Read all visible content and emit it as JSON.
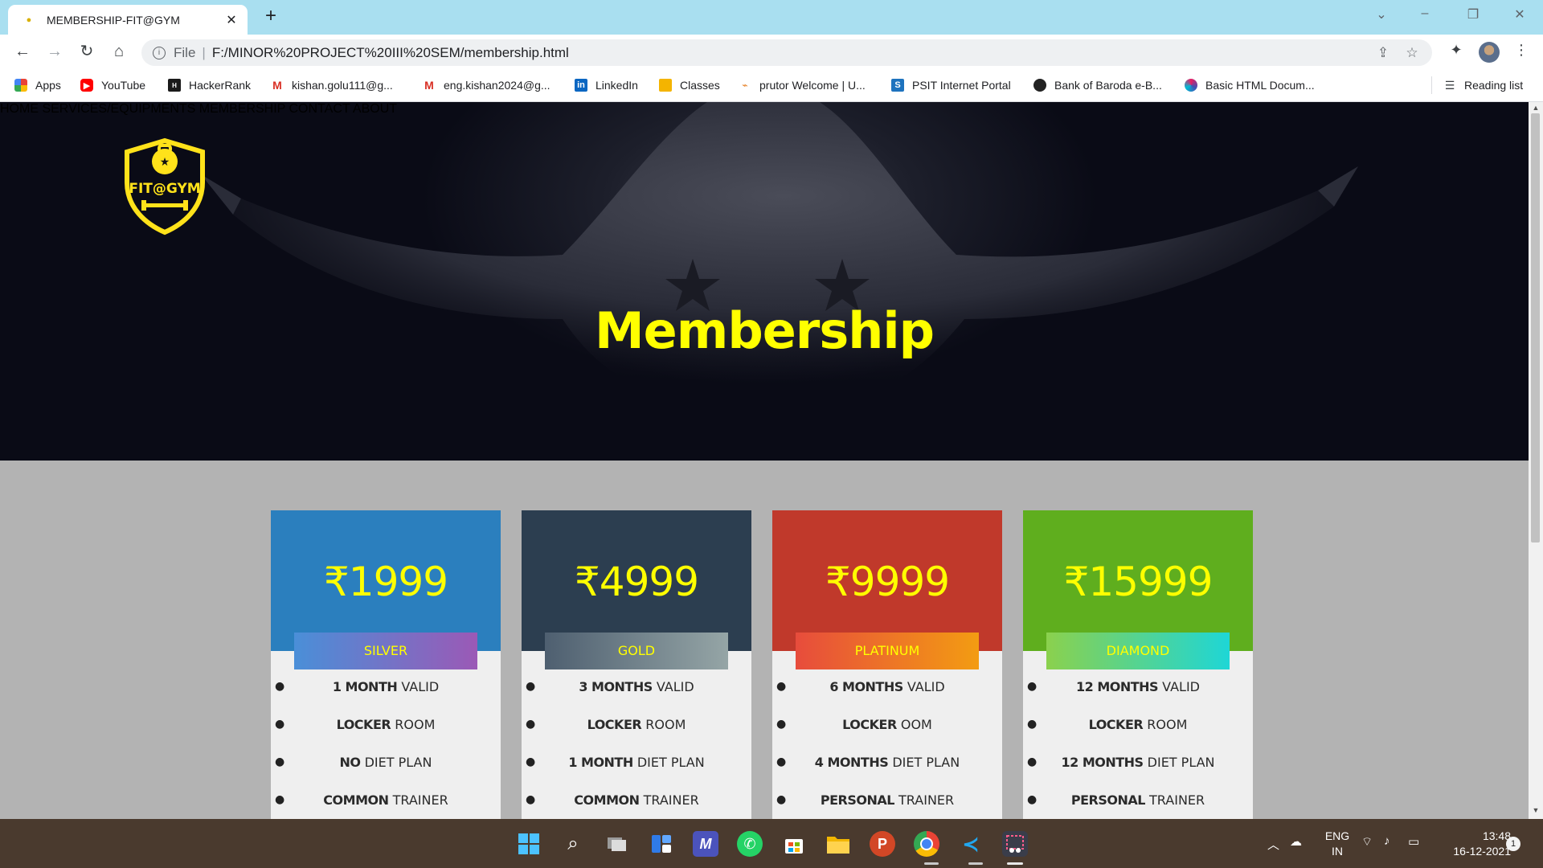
{
  "browser": {
    "tab_title": "MEMBERSHIP-FIT@GYM",
    "url_scheme": "File",
    "url": "F:/MINOR%20PROJECT%20III%20SEM/membership.html",
    "reading_list": "Reading list",
    "bookmarks": [
      {
        "label": "Apps",
        "icon": "apps-grid-icon"
      },
      {
        "label": "YouTube",
        "icon": "youtube-icon"
      },
      {
        "label": "HackerRank",
        "icon": "hackerrank-icon"
      },
      {
        "label": "kishan.golu111@g...",
        "icon": "gmail-icon"
      },
      {
        "label": "eng.kishan2024@g...",
        "icon": "gmail-icon"
      },
      {
        "label": "LinkedIn",
        "icon": "linkedin-icon"
      },
      {
        "label": "Classes",
        "icon": "classroom-icon"
      },
      {
        "label": "prutor Welcome | U...",
        "icon": "prutor-icon"
      },
      {
        "label": "PSIT Internet Portal",
        "icon": "psit-icon"
      },
      {
        "label": "Bank of Baroda e-B...",
        "icon": "globe-icon"
      },
      {
        "label": "Basic HTML Docum...",
        "icon": "swirl-icon"
      }
    ]
  },
  "site": {
    "logo_text": "FIT@GYM",
    "nav": [
      "HOME",
      "SERVICES/EQUIPMENTS",
      "MEMBERSHIP",
      "CONTACT",
      "ABOUT"
    ],
    "page_title": "Membership"
  },
  "plans": [
    {
      "price": "₹1999",
      "tier": "SILVER",
      "color": "#2b7fbe",
      "tier_gradient": [
        "#4a8fd8",
        "#9b59b6"
      ],
      "features": [
        [
          "1 MONTH",
          "VALID"
        ],
        [
          "LOCKER",
          "ROOM"
        ],
        [
          "NO",
          "DIET PLAN"
        ],
        [
          "COMMON",
          "TRAINER"
        ]
      ]
    },
    {
      "price": "₹4999",
      "tier": "GOLD",
      "color": "#2c3e50",
      "tier_gradient": [
        "#4e5f70",
        "#95a5a6"
      ],
      "features": [
        [
          "3 MONTHS",
          "VALID"
        ],
        [
          "LOCKER",
          "ROOM"
        ],
        [
          "1 MONTH",
          "DIET PLAN"
        ],
        [
          "COMMON",
          "TRAINER"
        ]
      ]
    },
    {
      "price": "₹9999",
      "tier": "PLATINUM",
      "color": "#c0392b",
      "tier_gradient": [
        "#e74c3c",
        "#f39c12"
      ],
      "features": [
        [
          "6 MONTHS",
          "VALID"
        ],
        [
          "LOCKER",
          "OOM"
        ],
        [
          "4 MONTHS",
          "DIET PLAN"
        ],
        [
          "PERSONAL",
          "TRAINER"
        ]
      ]
    },
    {
      "price": "₹15999",
      "tier": "DIAMOND",
      "color": "#5fae1e",
      "tier_gradient": [
        "#8bd14d",
        "#1ed6d6"
      ],
      "features": [
        [
          "12 MONTHS",
          "VALID"
        ],
        [
          "LOCKER",
          "ROOM"
        ],
        [
          "12 MONTHS",
          "DIET PLAN"
        ],
        [
          "PERSONAL",
          "TRAINER"
        ]
      ]
    }
  ],
  "taskbar": {
    "apps": [
      "windows-start-icon",
      "search-icon",
      "task-view-icon",
      "widgets-icon",
      "teams-icon",
      "whatsapp-icon",
      "store-icon",
      "file-explorer-icon",
      "powerpoint-icon",
      "chrome-icon",
      "vscode-icon",
      "snipping-tool-icon"
    ],
    "lang_top": "ENG",
    "lang_bottom": "IN",
    "time": "13:48",
    "date": "16-12-2021",
    "notification_count": "1"
  }
}
